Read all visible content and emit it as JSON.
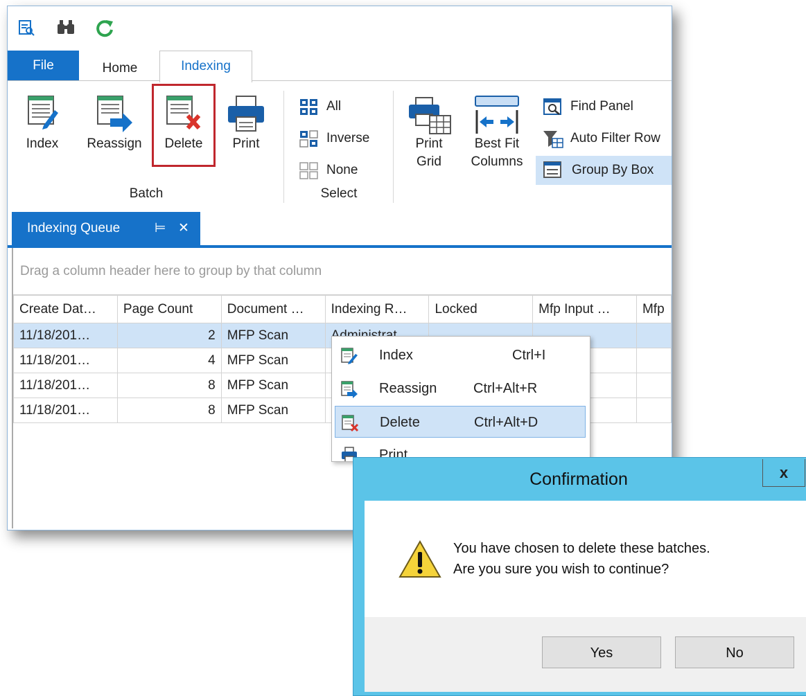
{
  "ribbon_tabs": {
    "file": "File",
    "home": "Home",
    "indexing": "Indexing"
  },
  "batch_group": {
    "label": "Batch",
    "index": "Index",
    "reassign": "Reassign",
    "delete": "Delete",
    "print": "Print"
  },
  "select_group": {
    "label": "Select",
    "all": "All",
    "inverse": "Inverse",
    "none": "None"
  },
  "grid_group": {
    "print_grid_1": "Print",
    "print_grid_2": "Grid",
    "best_fit_1": "Best Fit",
    "best_fit_2": "Columns",
    "find_panel": "Find Panel",
    "auto_filter_row": "Auto Filter Row",
    "group_by_box": "Group By Box"
  },
  "doc_tab": {
    "title": "Indexing Queue"
  },
  "group_hint": "Drag a column header here to group by that column",
  "grid": {
    "columns": [
      "Create Dat…",
      "Page Count",
      "Document …",
      "Indexing R…",
      "Locked",
      "Mfp Input …",
      "Mfp"
    ],
    "rows": [
      [
        "11/18/201…",
        "2",
        "MFP Scan",
        "Administrat",
        "",
        "",
        ""
      ],
      [
        "11/18/201…",
        "4",
        "MFP Scan",
        "",
        "",
        "",
        ""
      ],
      [
        "11/18/201…",
        "8",
        "MFP Scan",
        "",
        "",
        "",
        ""
      ],
      [
        "11/18/201…",
        "8",
        "MFP Scan",
        "",
        "",
        "",
        ""
      ]
    ]
  },
  "context_menu": {
    "index": {
      "label": "Index",
      "shortcut": "Ctrl+I"
    },
    "reassign": {
      "label": "Reassign",
      "shortcut": "Ctrl+Alt+R"
    },
    "delete": {
      "label": "Delete",
      "shortcut": "Ctrl+Alt+D"
    },
    "print": {
      "label": "Print",
      "shortcut": ""
    }
  },
  "dialog": {
    "title": "Confirmation",
    "close": "x",
    "line1": "You have chosen to delete these batches.",
    "line2": "Are you sure you wish to continue?",
    "yes": "Yes",
    "no": "No"
  },
  "colors": {
    "accent": "#1672c9",
    "dialog_frame": "#5bc4e8",
    "selection": "#cfe3f7",
    "highlight": "#c0272d"
  }
}
